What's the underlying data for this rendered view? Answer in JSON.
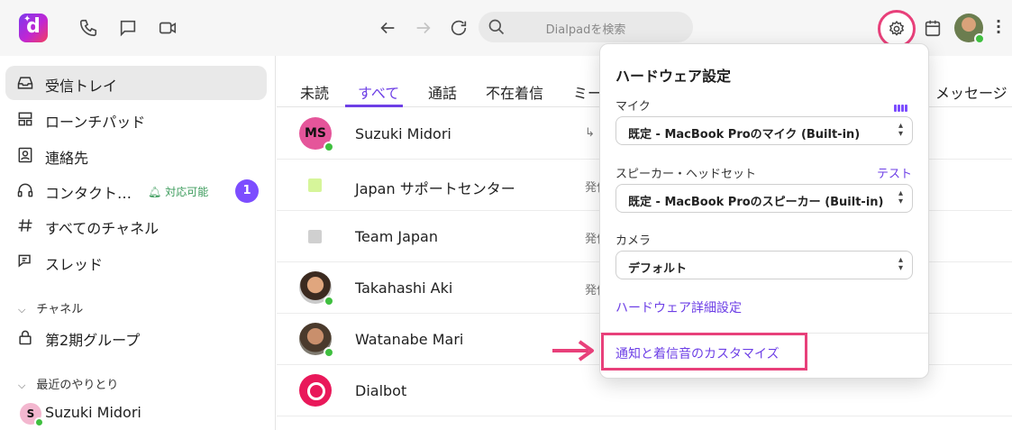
{
  "app": {
    "logo_letter": "d",
    "search_placeholder": "Dialpadを検索"
  },
  "colors": {
    "accent": "#6d3fe6",
    "highlight": "#e8407a",
    "online": "#3fbf3f"
  },
  "sidebar": {
    "items": [
      {
        "label": "受信トレイ",
        "icon": "inbox-icon",
        "active": true
      },
      {
        "label": "ローンチパッド",
        "icon": "launchpad-icon"
      },
      {
        "label": "連絡先",
        "icon": "contacts-icon"
      },
      {
        "label": "コンタクト…",
        "icon": "headset-icon",
        "status": "対応可能",
        "badge": "1"
      },
      {
        "label": "すべてのチャネル",
        "icon": "hash-icon"
      },
      {
        "label": "スレッド",
        "icon": "threads-icon"
      }
    ],
    "channels_section": "チャネル",
    "channels": [
      {
        "label": "第2期グループ",
        "icon": "lock-icon"
      }
    ],
    "recent_section": "最近のやりとり",
    "recent": [
      {
        "label": "Suzuki Midori",
        "initial": "S"
      }
    ]
  },
  "tabs": [
    "未読",
    "すべて",
    "通話",
    "不在着信",
    "ミー",
    "メッセージ"
  ],
  "active_tab": "すべて",
  "conversations": [
    {
      "name": "Suzuki Midori",
      "initials": "MS",
      "meta": "↳"
    },
    {
      "name": "Japan サポートセンター",
      "meta": "発信"
    },
    {
      "name": "Team Japan",
      "meta": "発信"
    },
    {
      "name": "Takahashi Aki",
      "meta": "発信"
    },
    {
      "name": "Watanabe Mari",
      "meta": ""
    },
    {
      "name": "Dialbot",
      "meta": ""
    }
  ],
  "hardware_popover": {
    "title": "ハードウェア設定",
    "mic_label": "マイク",
    "mic_value": "既定 - MacBook Proのマイク (Built-in)",
    "speaker_label": "スピーカー・ヘッドセット",
    "speaker_test": "テスト",
    "speaker_value": "既定 - MacBook Proのスピーカー (Built-in)",
    "camera_label": "カメラ",
    "camera_value": "デフォルト",
    "advanced_link": "ハードウェア詳細設定",
    "notify_link": "通知と着信音のカスタマイズ"
  }
}
